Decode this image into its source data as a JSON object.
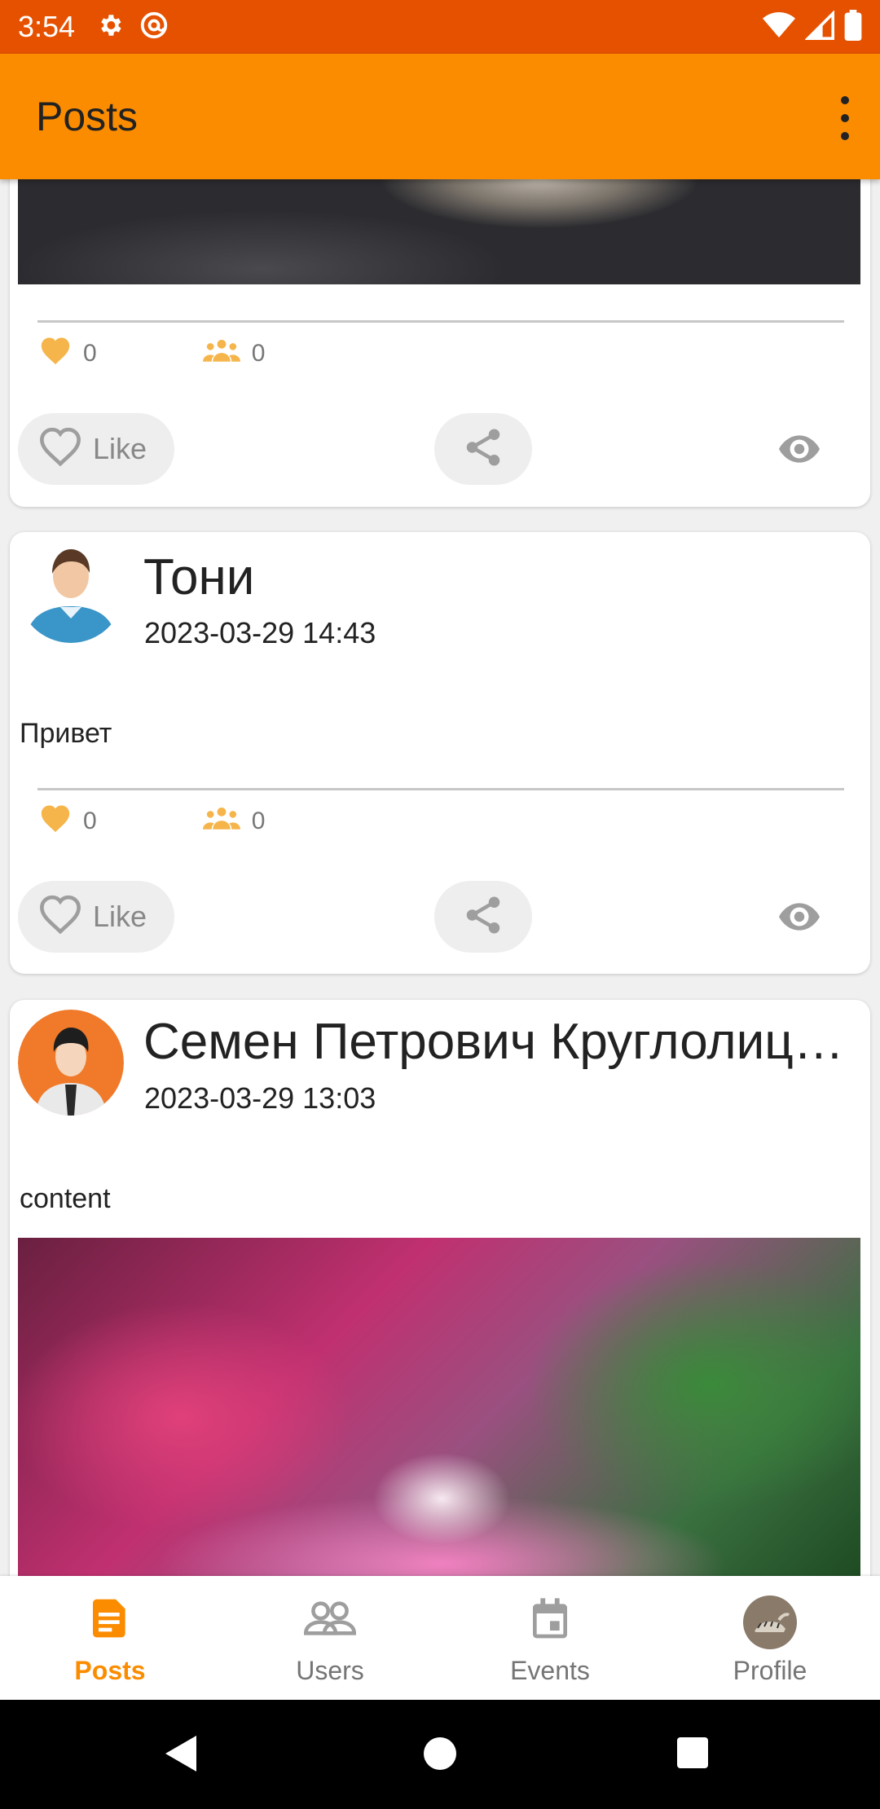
{
  "status_bar": {
    "time": "3:54"
  },
  "app_bar": {
    "title": "Posts"
  },
  "posts": [
    {
      "likes": "0",
      "reposts": "0",
      "like_label": "Like"
    },
    {
      "author": "Тони",
      "date": "2023-03-29 14:43",
      "content": "Привет",
      "likes": "0",
      "reposts": "0",
      "like_label": "Like"
    },
    {
      "author": "Семен Петрович Круглолицый",
      "date": "2023-03-29 13:03",
      "content": "content"
    }
  ],
  "bottom_nav": [
    {
      "label": "Posts",
      "active": true
    },
    {
      "label": "Users",
      "active": false
    },
    {
      "label": "Events",
      "active": false
    },
    {
      "label": "Profile",
      "active": false
    }
  ],
  "colors": {
    "accent": "#fb8c00",
    "status_bar": "#e65100",
    "inactive": "#757575"
  }
}
